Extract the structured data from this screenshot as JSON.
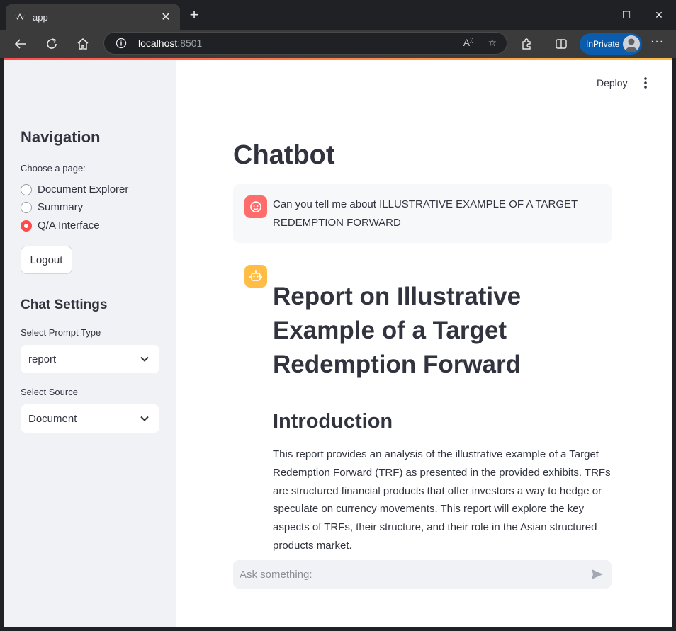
{
  "browser": {
    "tab_title": "app",
    "url_host": "localhost",
    "url_port": ":8501",
    "inprivate_label": "InPrivate",
    "icons": [
      "back-icon",
      "refresh-icon",
      "home-icon",
      "info-icon",
      "read-aloud-icon",
      "favorite-star-icon",
      "extensions-icon",
      "split-screen-icon",
      "more-icon"
    ]
  },
  "header": {
    "deploy_label": "Deploy"
  },
  "sidebar": {
    "navigation_title": "Navigation",
    "choose_page_label": "Choose a page:",
    "pages": [
      {
        "label": "Document Explorer",
        "selected": false
      },
      {
        "label": "Summary",
        "selected": false
      },
      {
        "label": "Q/A Interface",
        "selected": true
      }
    ],
    "logout_label": "Logout",
    "chat_settings_title": "Chat Settings",
    "prompt_type_label": "Select Prompt Type",
    "prompt_type_value": "report",
    "source_label": "Select Source",
    "source_value": "Document"
  },
  "main": {
    "title": "Chatbot",
    "user_message": "Can you tell me about ILLUSTRATIVE EXAMPLE OF A TARGET REDEMPTION FORWARD",
    "assistant": {
      "heading": "Report on Illustrative Example of a Target Redemption Forward",
      "subheading": "Introduction",
      "paragraph": "This report provides an analysis of the illustrative example of a Target Redemption Forward (TRF) as presented in the provided exhibits. TRFs are structured financial products that offer investors a way to hedge or speculate on currency movements. This report will explore the key aspects of TRFs, their structure, and their role in the Asian structured products market."
    },
    "chat_input_placeholder": "Ask something:"
  },
  "colors": {
    "accent": "#ff4b4b",
    "user_avatar": "#ff6c6c",
    "bot_avatar": "#ffbd45",
    "sidebar_bg": "#f0f2f6",
    "text": "#31333f",
    "inprivate": "#0b5cad"
  }
}
